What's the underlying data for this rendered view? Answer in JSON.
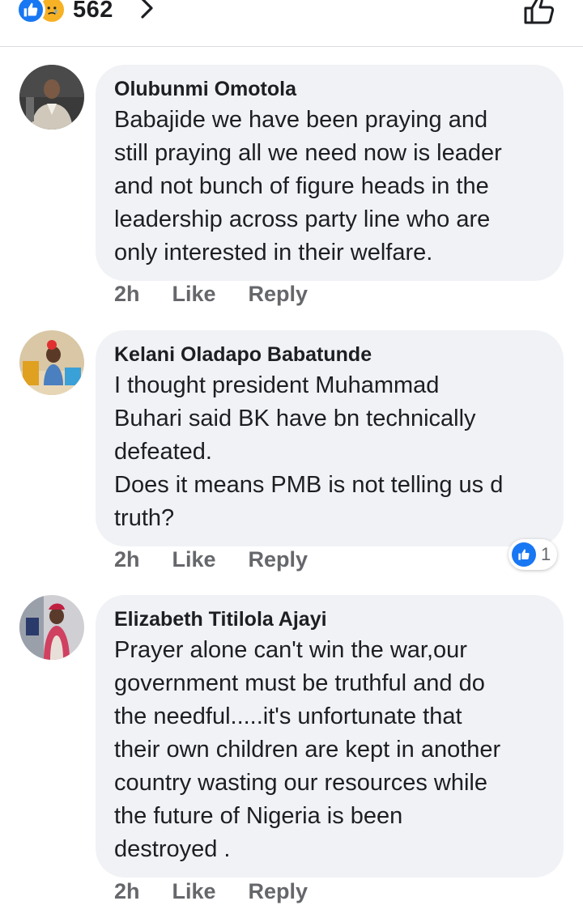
{
  "reactions": {
    "count": "562",
    "icons": [
      "like-icon",
      "sad-icon"
    ]
  },
  "comments": [
    {
      "author": "Olubunmi Omotola",
      "text": "Babajide we have been praying and\nstill praying all we need now is leader\nand not bunch of figure heads in the\nleadership across party line who are\nonly interested in their welfare.",
      "time": "2h",
      "like_label": "Like",
      "reply_label": "Reply"
    },
    {
      "author": "Kelani Oladapo Babatunde",
      "text": "I thought president Muhammad\nBuhari said BK have bn technically\ndefeated.\nDoes it means PMB is not telling us d\ntruth?",
      "time": "2h",
      "like_label": "Like",
      "reply_label": "Reply",
      "reaction_count": "1"
    },
    {
      "author": "Elizabeth Titilola Ajayi",
      "text": "Prayer alone can't win the war,our\ngovernment must be truthful and do\nthe needful.....it's unfortunate that\ntheir own children are kept in another\ncountry wasting our resources while\nthe future of Nigeria is been\ndestroyed .",
      "time": "2h",
      "like_label": "Like",
      "reply_label": "Reply"
    }
  ],
  "colors": {
    "brand_blue": "#1877f2",
    "bubble_bg": "#f0f2f5",
    "meta_gray": "#65676b"
  }
}
